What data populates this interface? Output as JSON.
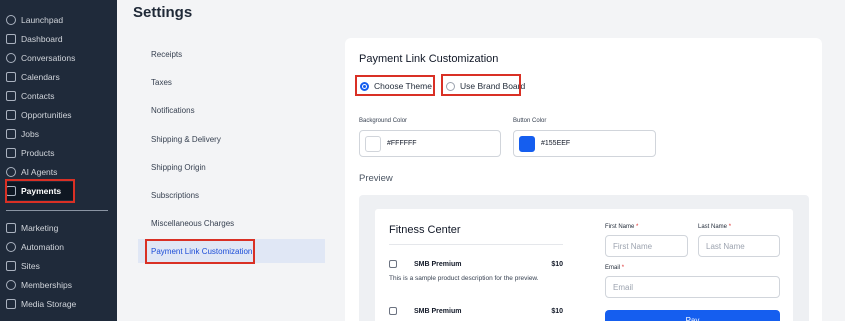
{
  "sidebar": {
    "items": [
      {
        "label": "Launchpad",
        "icon": "rocket-icon"
      },
      {
        "label": "Dashboard",
        "icon": "grid-icon"
      },
      {
        "label": "Conversations",
        "icon": "chat-bubble-icon"
      },
      {
        "label": "Calendars",
        "icon": "calendar-icon"
      },
      {
        "label": "Contacts",
        "icon": "contacts-icon"
      },
      {
        "label": "Opportunities",
        "icon": "opportunities-icon"
      },
      {
        "label": "Jobs",
        "icon": "briefcase-icon"
      },
      {
        "label": "Products",
        "icon": "box-icon"
      },
      {
        "label": "AI Agents",
        "icon": "sparkle-icon"
      },
      {
        "label": "Payments",
        "icon": "wallet-icon"
      },
      {
        "label": "Marketing",
        "icon": "send-icon"
      },
      {
        "label": "Automation",
        "icon": "automation-icon"
      },
      {
        "label": "Sites",
        "icon": "sites-icon"
      },
      {
        "label": "Memberships",
        "icon": "membership-icon"
      },
      {
        "label": "Media Storage",
        "icon": "image-icon"
      }
    ]
  },
  "header": {
    "title": "Settings"
  },
  "settings_menu": {
    "items": [
      {
        "label": "Receipts"
      },
      {
        "label": "Taxes"
      },
      {
        "label": "Notifications"
      },
      {
        "label": "Shipping & Delivery"
      },
      {
        "label": "Shipping Origin"
      },
      {
        "label": "Subscriptions"
      },
      {
        "label": "Miscellaneous Charges"
      },
      {
        "label": "Payment Link Customization"
      }
    ]
  },
  "customization": {
    "title": "Payment Link Customization",
    "theme_options": [
      {
        "label": "Choose Theme",
        "selected": true
      },
      {
        "label": "Use Brand Board",
        "selected": false
      }
    ],
    "background_color": {
      "label": "Background Color",
      "value": "#FFFFFF"
    },
    "button_color": {
      "label": "Button Color",
      "value": "#155EEF"
    },
    "preview_label": "Preview"
  },
  "preview": {
    "business_name": "Fitness Center",
    "products": [
      {
        "name": "SMB Premium",
        "price": "$10"
      },
      {
        "name": "SMB Premium",
        "price": "$10"
      }
    ],
    "product_description": "This is a sample product description for the preview.",
    "form": {
      "first_name_label": "First Name",
      "first_name_placeholder": "First Name",
      "last_name_label": "Last Name",
      "last_name_placeholder": "Last Name",
      "email_label": "Email",
      "email_placeholder": "Email",
      "required_mark": "*",
      "pay_label": "Pay"
    }
  },
  "colors": {
    "sidebar": "#1f2a3a",
    "accent": "#155EEF",
    "highlight": "#d93025"
  }
}
